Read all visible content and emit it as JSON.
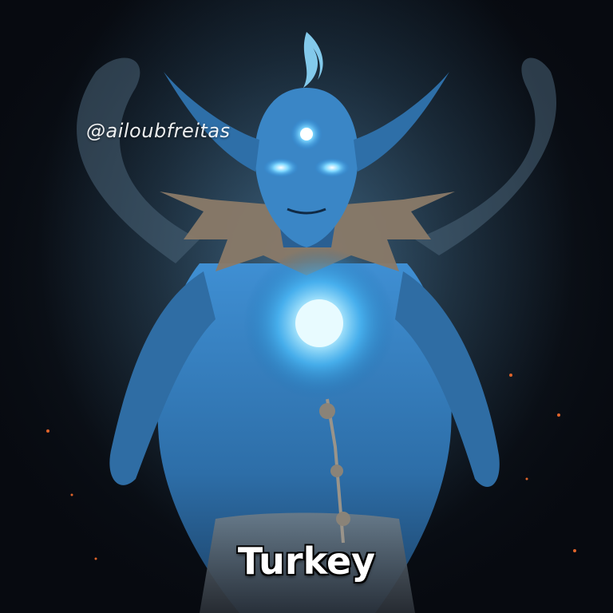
{
  "image": {
    "subject": "blue-glowing-demon-figure",
    "palette": {
      "skin": "#3d8fd0",
      "glow": "#7fd8ff",
      "background": "#0a1018",
      "fog": "#3b5f78",
      "armor": "#8a7a68",
      "ember": "#e0642a"
    }
  },
  "watermark": {
    "text": "@ailoubfreitas"
  },
  "caption": {
    "text": "Turkey"
  }
}
